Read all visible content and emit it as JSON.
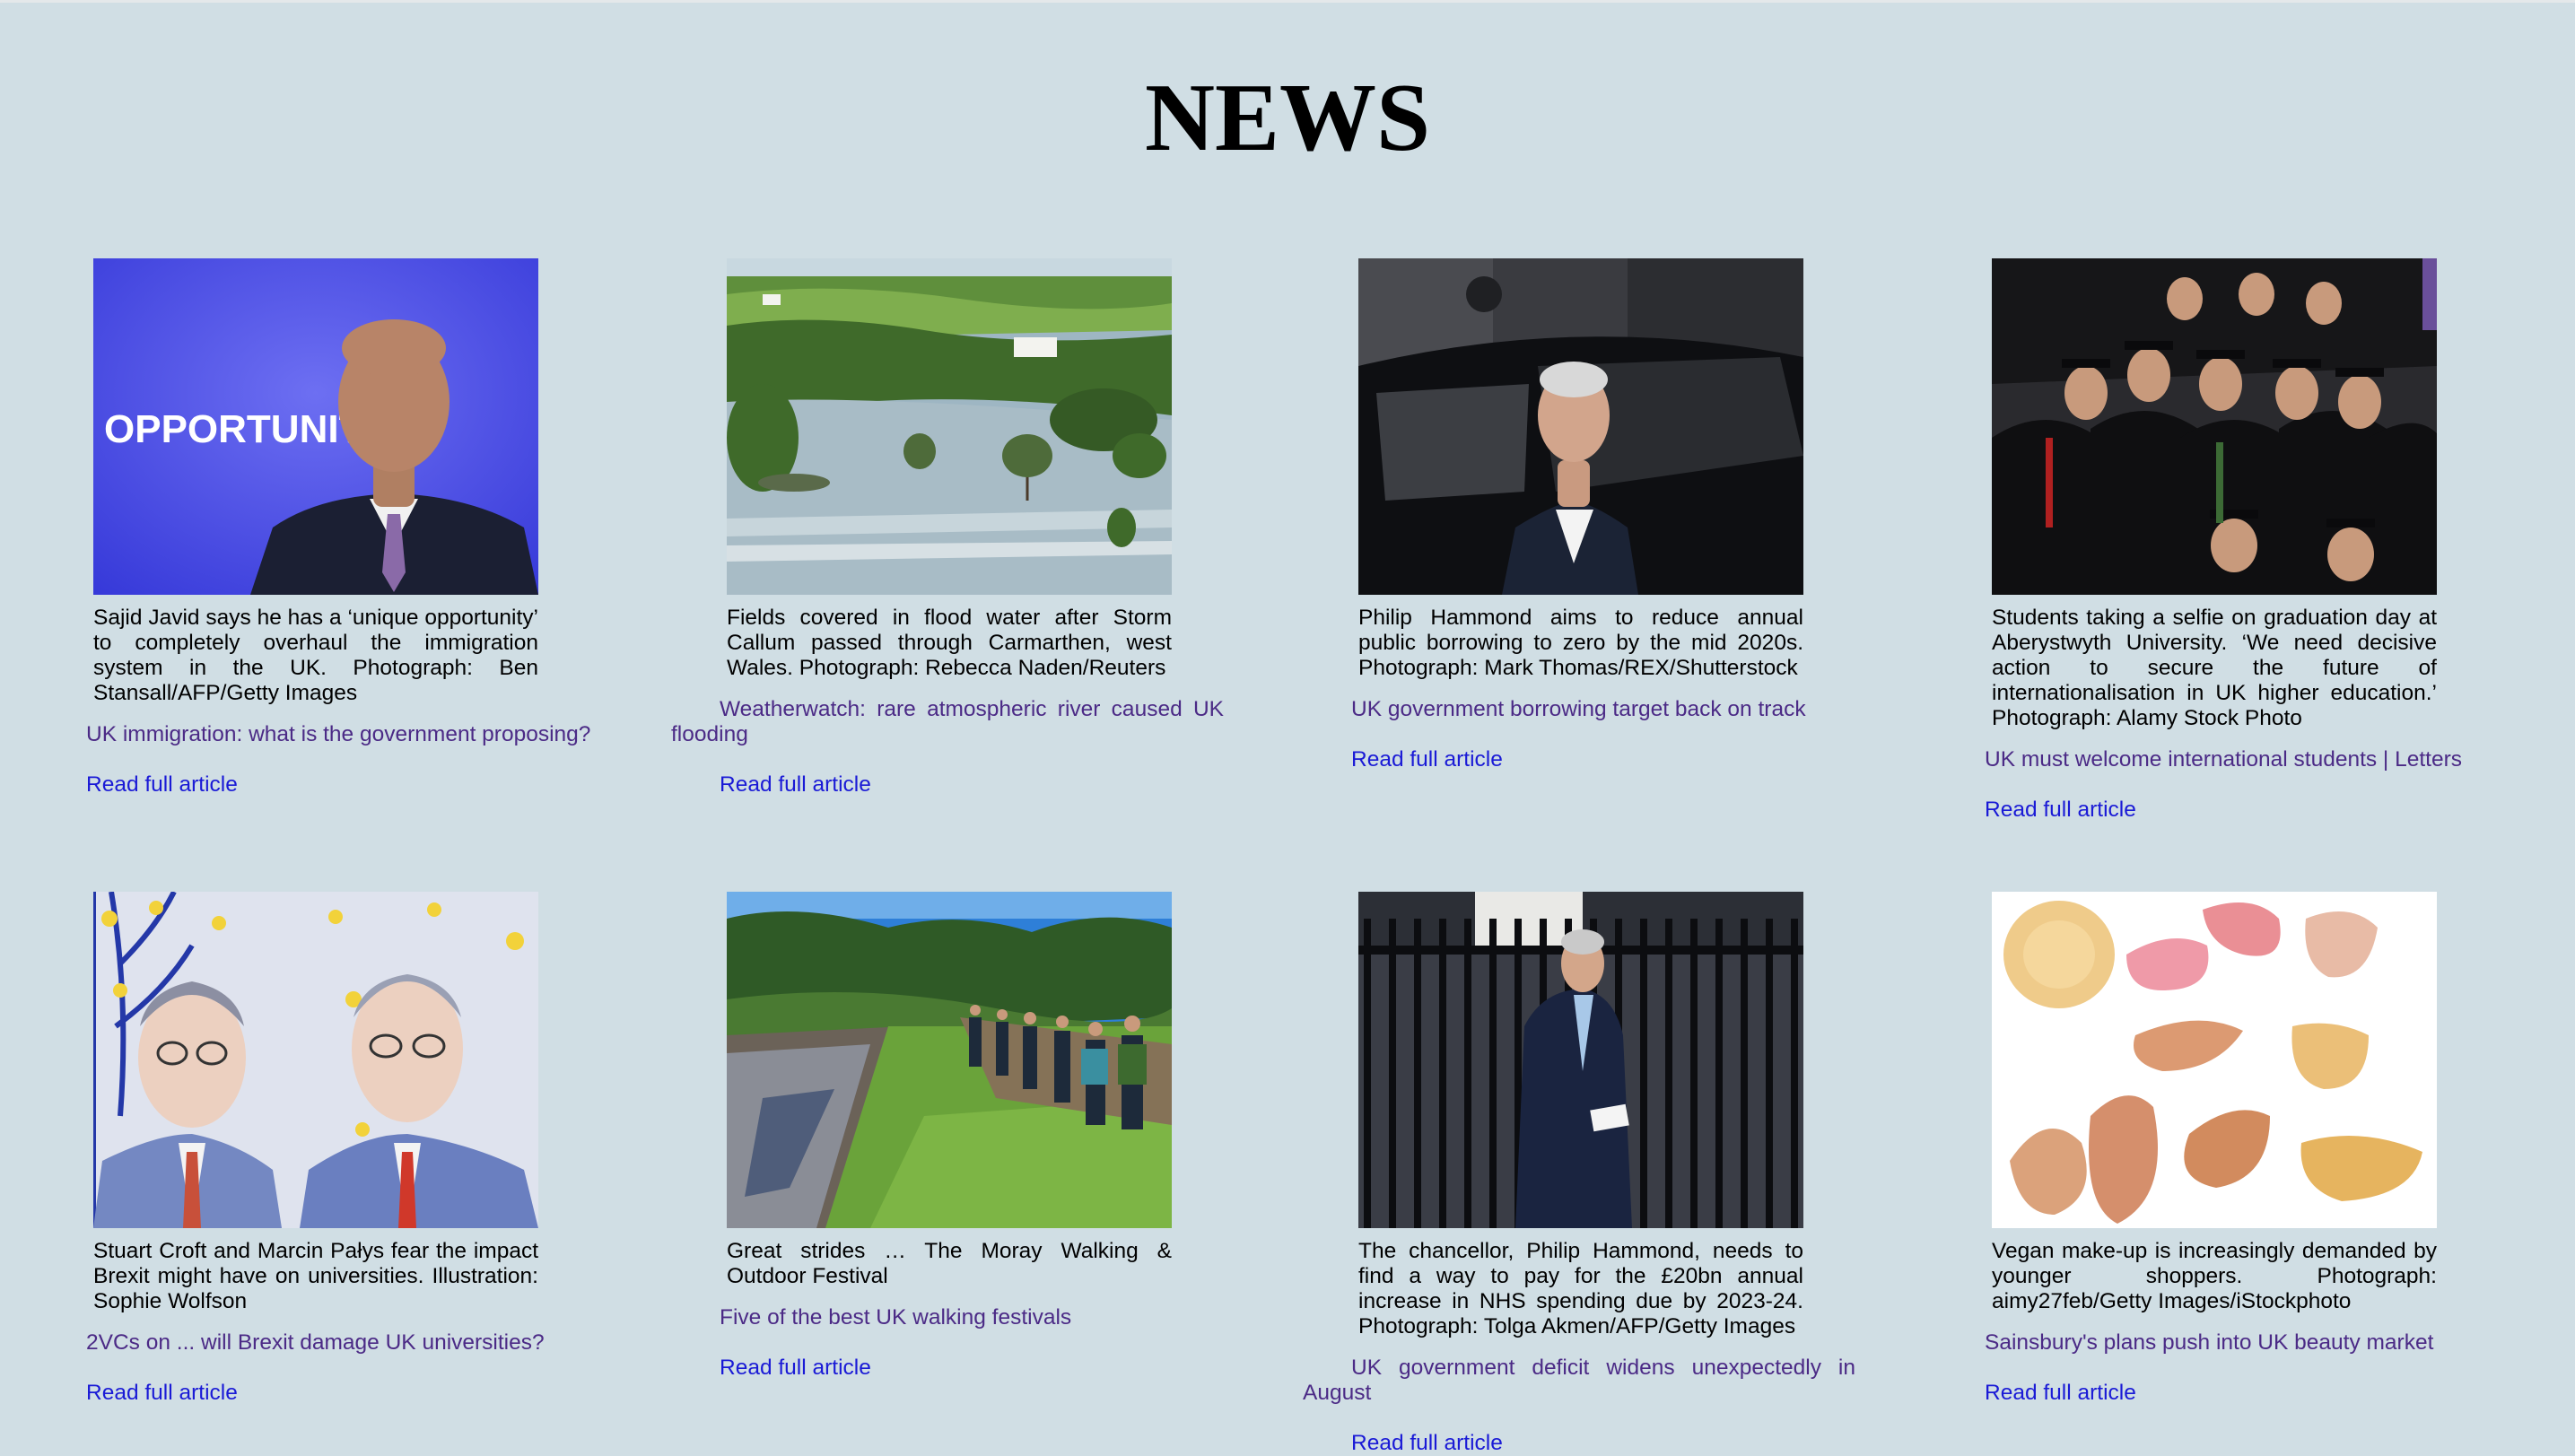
{
  "page": {
    "title": "NEWS"
  },
  "articles": [
    {
      "image_label": "OPPORTUNITY",
      "caption": "Sajid Javid says he has a ‘unique opportunity’ to completely overhaul the immigration system in the UK. Photograph: Ben Stansall/AFP/Getty Images",
      "headline": "UK immigration: what is the government proposing?",
      "read_more": "Read full article"
    },
    {
      "caption": "Fields covered in flood water after Storm Callum passed through Carmarthen, west Wales. Photograph: Rebecca Naden/Reuters",
      "headline": "Weatherwatch: rare atmospheric river caused UK flooding",
      "read_more": "Read full article"
    },
    {
      "caption": "Philip Hammond aims to reduce annual public borrowing to zero by the mid 2020s. Photograph: Mark Thomas/REX/Shutterstock",
      "headline": "UK government borrowing target back on track",
      "read_more": "Read full article"
    },
    {
      "caption": "Students taking a selfie on graduation day at Aberystwyth University. ‘We need decisive action to secure the future of internationalisation in UK higher education.’ Photograph: Alamy Stock Photo",
      "headline": "UK must welcome international students | Letters",
      "read_more": "Read full article"
    },
    {
      "caption": "Stuart Croft and Marcin Pałys fear the impact Brexit might have on universities. Illustration: Sophie Wolfson",
      "headline": "2VCs on ... will Brexit damage UK universities?",
      "read_more": "Read full article"
    },
    {
      "caption": "Great strides … The Moray Walking & Outdoor Festival",
      "headline": "Five of the best UK walking festivals",
      "read_more": "Read full article"
    },
    {
      "caption": "The chancellor, Philip Hammond, needs to find a way to pay for the £20bn annual increase in NHS spending due by 2023-24. Photograph: Tolga Akmen/AFP/Getty Images",
      "headline": "UK government deficit widens unexpectedly in August",
      "read_more": "Read full article"
    },
    {
      "caption": "Vegan make-up is increasingly demanded by younger shoppers. Photograph: aimy27feb/Getty Images/iStockphoto",
      "headline": "Sainsbury's plans push into UK beauty market",
      "read_more": "Read full article"
    }
  ],
  "colors": {
    "background": "#d0dee4",
    "headline_link": "#4b2a86",
    "read_more_link": "#1a1ad6"
  }
}
